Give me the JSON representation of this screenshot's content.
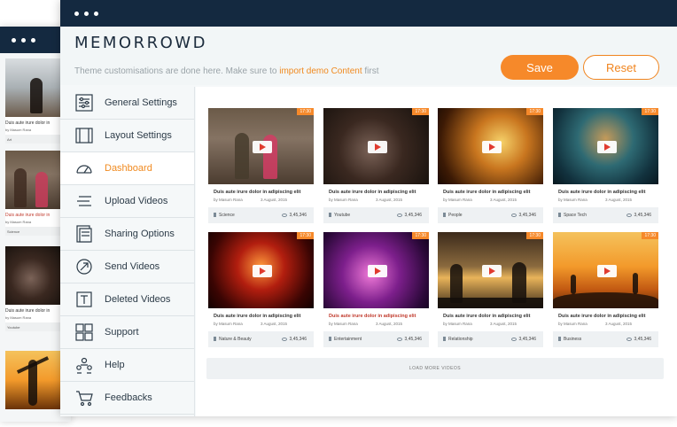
{
  "back_window": {
    "cards": [
      {
        "title": "Duis aute irure dolor in",
        "author": "by Masum Rana",
        "category": "Art",
        "title_orange": false
      },
      {
        "title": "Duis aute irure dolor in",
        "author": "by Masum Rana",
        "category": "Science",
        "title_orange": true
      },
      {
        "title": "Duis aute irure dolor in",
        "author": "by Masum Rana",
        "category": "Youtube",
        "title_orange": false
      },
      {
        "title": "",
        "author": "",
        "category": "",
        "title_orange": false
      }
    ]
  },
  "header": {
    "logo": "MEMORROWD",
    "notice_prefix": "Theme customisations are done here. Make sure to",
    "notice_link": "import demo Content",
    "notice_suffix": "first",
    "save_label": "Save",
    "reset_label": "Reset"
  },
  "sidebar": {
    "items": [
      {
        "label": "General Settings",
        "icon": "sliders-icon",
        "active": false
      },
      {
        "label": "Layout Settings",
        "icon": "layout-icon",
        "active": false
      },
      {
        "label": "Dashboard",
        "icon": "gauge-icon",
        "active": true
      },
      {
        "label": "Upload Videos",
        "icon": "upload-icon",
        "active": false
      },
      {
        "label": "Sharing Options",
        "icon": "share-document-icon",
        "active": false
      },
      {
        "label": "Send Videos",
        "icon": "send-icon",
        "active": false
      },
      {
        "label": "Deleted Videos",
        "icon": "text-frame-icon",
        "active": false
      },
      {
        "label": "Support",
        "icon": "grid-icon",
        "active": false
      },
      {
        "label": "Help",
        "icon": "users-icon",
        "active": false
      },
      {
        "label": "Feedbacks",
        "icon": "cart-icon",
        "active": false
      }
    ]
  },
  "videos": [
    {
      "duration": "17:30",
      "title": "Duis aute irure dolor in adipiscing elit",
      "author": "by Masum Rana",
      "date": "3 August, 2015",
      "category": "Science",
      "views": "3,45,346",
      "title_orange": false
    },
    {
      "duration": "17:30",
      "title": "Duis aute irure dolor in adipiscing elit",
      "author": "by Masum Rana",
      "date": "3 August, 2015",
      "category": "Youtube",
      "views": "3,45,346",
      "title_orange": false
    },
    {
      "duration": "17:30",
      "title": "Duis aute irure dolor in adipiscing elit",
      "author": "by Masum Rana",
      "date": "3 August, 2015",
      "category": "People",
      "views": "3,45,346",
      "title_orange": false
    },
    {
      "duration": "17:30",
      "title": "Duis aute irure dolor in adipiscing elit",
      "author": "by Masum Rana",
      "date": "3 August, 2015",
      "category": "Space Tech",
      "views": "3,45,346",
      "title_orange": false
    },
    {
      "duration": "17:30",
      "title": "Duis aute irure dolor in adipiscing elit",
      "author": "by Masum Rana",
      "date": "3 August, 2015",
      "category": "Nature & Beauty",
      "views": "3,45,346",
      "title_orange": false
    },
    {
      "duration": "17:30",
      "title": "Duis aute irure dolor in adipiscing elit",
      "author": "by Masum Rana",
      "date": "3 August, 2015",
      "category": "Entertainment",
      "views": "3,45,346",
      "title_orange": true
    },
    {
      "duration": "17:30",
      "title": "Duis aute irure dolor in adipiscing elit",
      "author": "by Masum Rana",
      "date": "3 August, 2015",
      "category": "Relationship",
      "views": "3,45,346",
      "title_orange": false
    },
    {
      "duration": "17:30",
      "title": "Duis aute irure dolor in adipiscing elit",
      "author": "by Masum Rana",
      "date": "3 August, 2015",
      "category": "Business",
      "views": "3,45,346",
      "title_orange": false
    }
  ],
  "load_more_label": "LOAD MORE VIDEOS",
  "colors": {
    "accent": "#f6892a",
    "titlebar": "#142940",
    "active_text": "#f08a20"
  }
}
